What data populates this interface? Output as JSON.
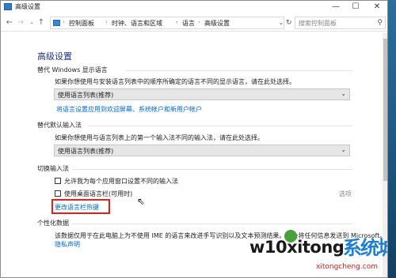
{
  "window": {
    "title": "高级设置",
    "min_glyph": "—",
    "max_glyph": "☐",
    "close_glyph": "✕"
  },
  "nav": {
    "back": "←",
    "forward": "→",
    "recent": "⌄",
    "up": "↑",
    "breadcrumb": [
      "控制面板",
      "时钟、语言和区域",
      "语言",
      "高级设置"
    ],
    "separator": "›",
    "dropdown_glyph": "⌄",
    "refresh_glyph": "↻",
    "search_placeholder": "搜索控制面板",
    "search_glyph": "⚲"
  },
  "page": {
    "title": "高级设置",
    "display_lang": {
      "heading": "替代 Windows 显示语言",
      "description": "如果你想使用与安装语言列表中的顺序所确定的语言不同的显示语言，请在此处选择。",
      "select_value": "使用语言列表(推荐)",
      "link": "将语言设置应用到欢迎屏幕、系统帐户和新用户帐户"
    },
    "input_method": {
      "heading": "替代默认输入法",
      "description": "如果你想使用与语言列表上的第一个输入法不同的输入法，请在此处选择。",
      "select_value": "使用语言列表(推荐)"
    },
    "switch_input": {
      "heading": "切换输入法",
      "checkbox1": "允许我为每个应用窗口设置不同的输入法",
      "checkbox2": "使用桌面语言栏(可用时)",
      "options": "选项",
      "link": "更改语言栏热键"
    },
    "personalization": {
      "heading": "个性化数据",
      "description": "该数据仅用于在此电脑上为不使用 IME 的语言来改进手写识别以及文本预测结果。不会将任何信息发送到 Microsoft。",
      "link": "隐私声明"
    }
  },
  "watermark": {
    "text": "w10xitong",
    "cn": "系统城",
    "url": "xitongcheng.com"
  },
  "colors": {
    "title_blue": "#1e3287",
    "link_blue": "#0066cc",
    "highlight_red": "#e0201c"
  }
}
